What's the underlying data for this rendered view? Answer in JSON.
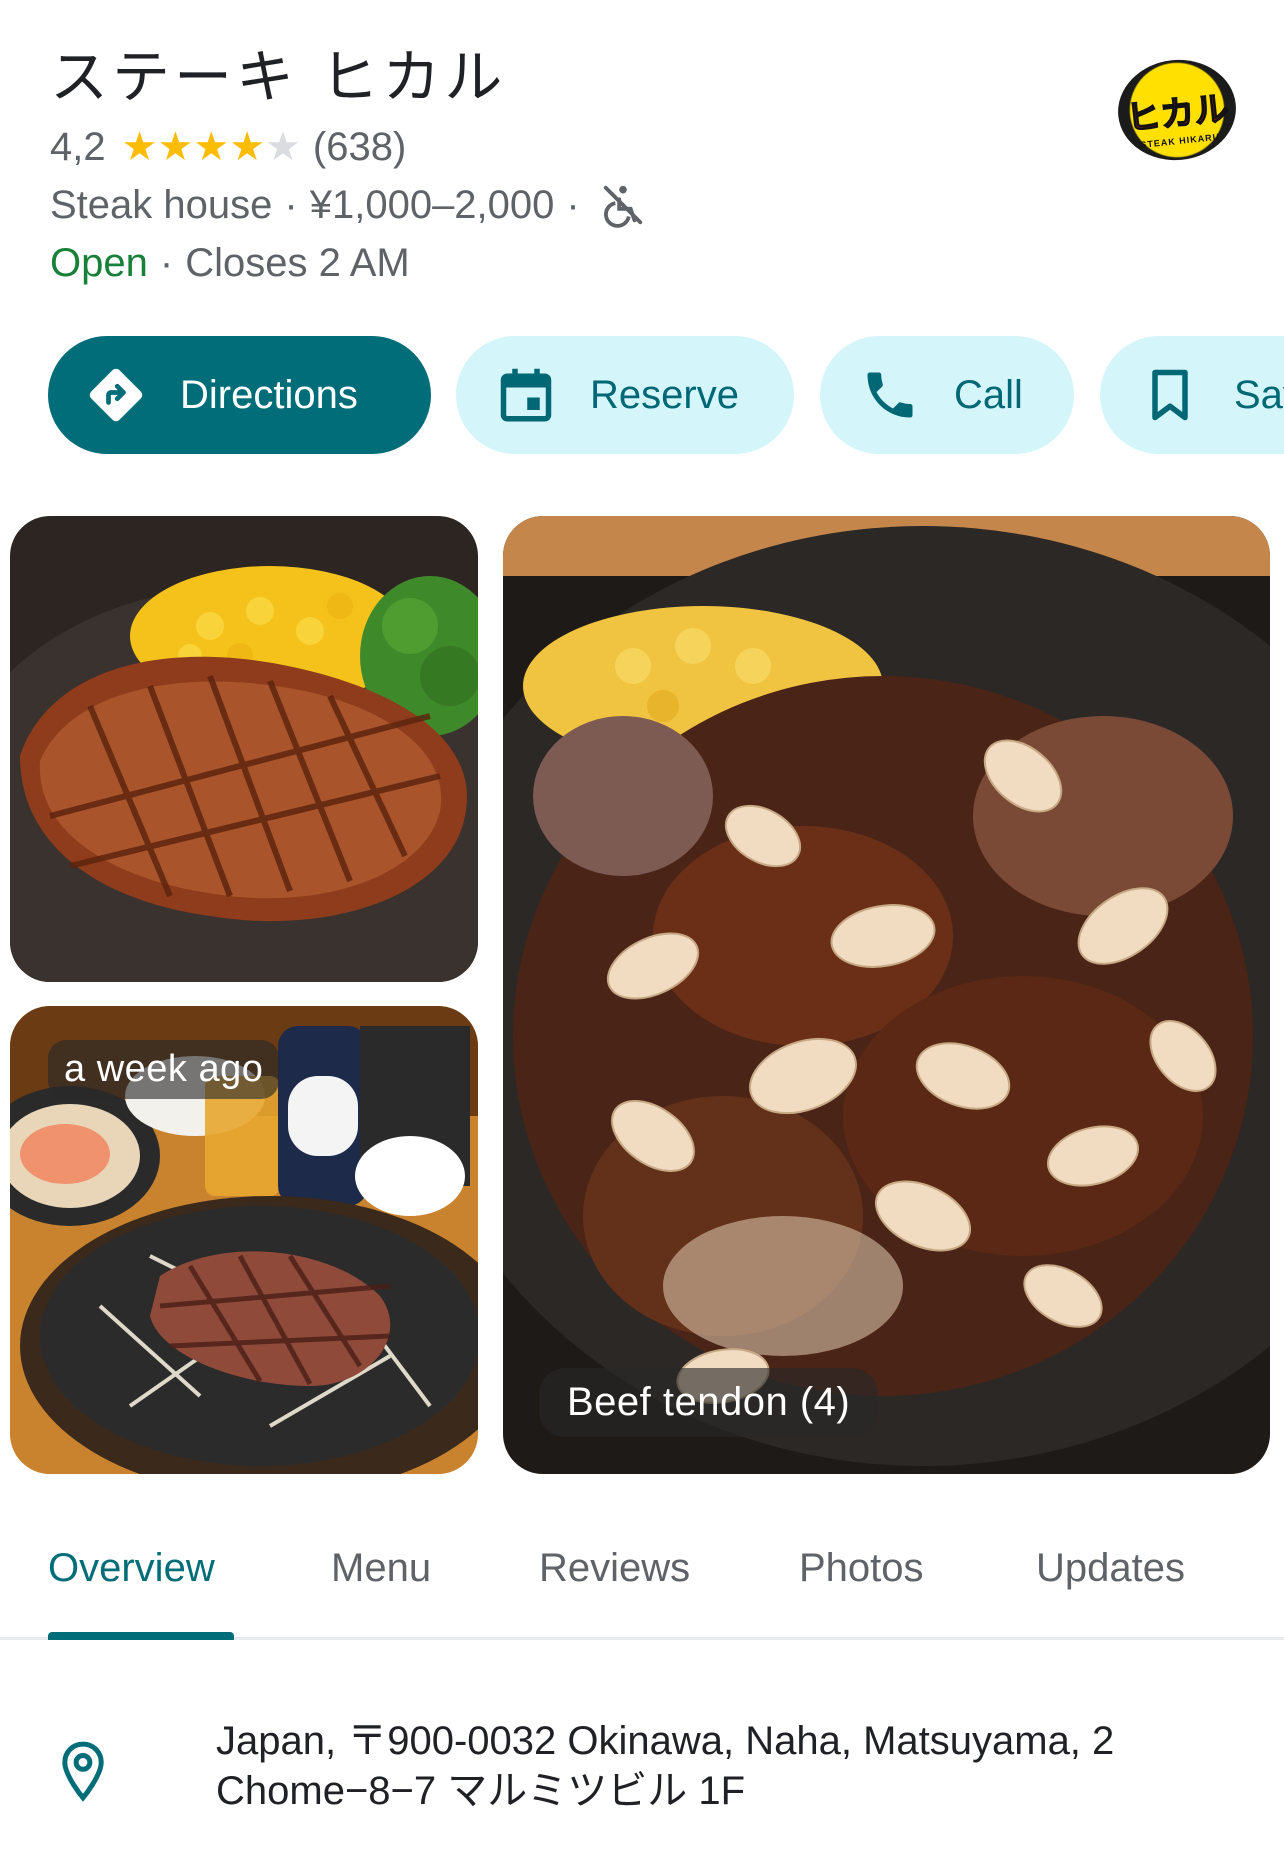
{
  "place": {
    "name": "ステーキ ヒカル",
    "rating": "4,2",
    "rating_value": 4.2,
    "review_count": "(638)",
    "category": "Steak house",
    "price_range": "¥1,000–2,000",
    "separator": "·",
    "accessibility_icon": "no-wheelchair-icon",
    "status": "Open",
    "hours": "Closes 2 AM",
    "logo_text": "ヒカル",
    "logo_small_text": "ステーキ",
    "logo_sub_text": "STEAK HIKARU"
  },
  "actions": [
    {
      "label": "Directions",
      "icon": "directions-icon"
    },
    {
      "label": "Reserve",
      "icon": "calendar-icon"
    },
    {
      "label": "Call",
      "icon": "phone-icon"
    },
    {
      "label": "Save",
      "icon": "bookmark-icon"
    }
  ],
  "photos": {
    "beer_chip": "a week ago",
    "tendon_chip": "Beef tendon (4)"
  },
  "tabs": [
    "Overview",
    "Menu",
    "Reviews",
    "Photos",
    "Updates"
  ],
  "active_tab": "Overview",
  "address": "Japan, 〒900-0032 Okinawa, Naha, Matsuyama, 2 Chome−8−7 マルミツビル 1F",
  "colors": {
    "accent": "#006d78",
    "button_bg": "#d4f6fb",
    "open": "#188038",
    "star": "#fbbc04"
  }
}
